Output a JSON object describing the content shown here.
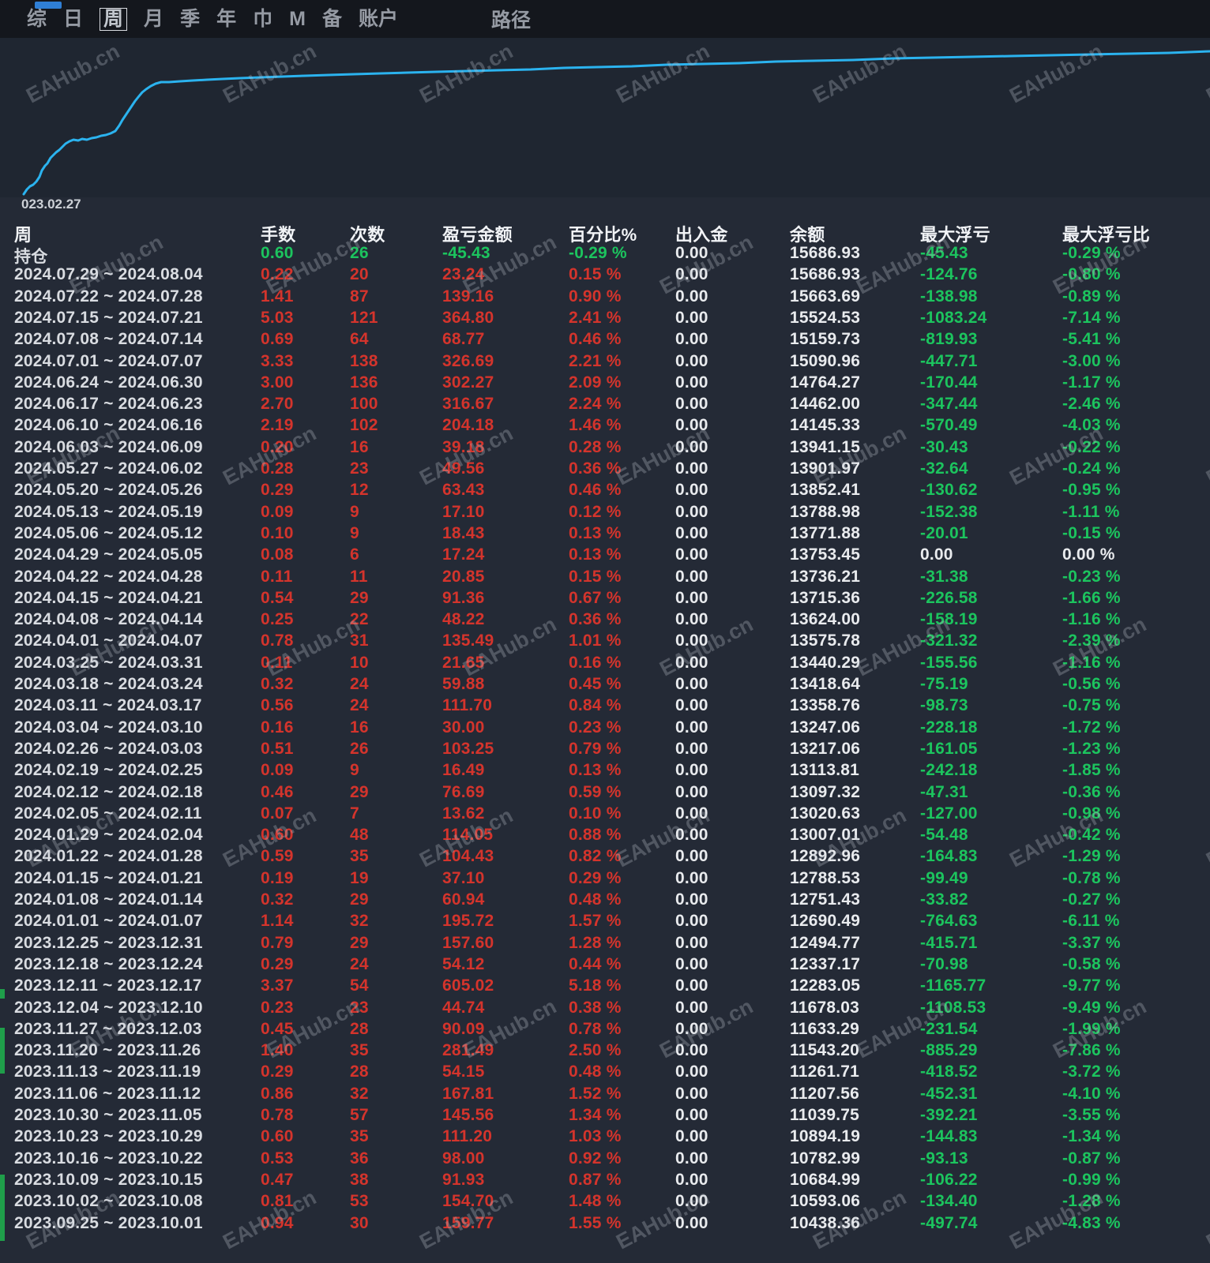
{
  "menu": {
    "items": [
      "综",
      "日",
      "周",
      "月",
      "季",
      "年",
      "巾",
      "M",
      "备",
      "账户"
    ],
    "selected_index": 2,
    "right_item": "路径"
  },
  "watermark": {
    "text": "EAHub.cn"
  },
  "chart": {
    "start_date_label": "023.02.27",
    "line_color": "#2bb3ef"
  },
  "chart_data": {
    "type": "line",
    "title": "",
    "xlabel": "",
    "ylabel": "",
    "x_start_label": "023.02.27",
    "legend": "none",
    "grid": false,
    "line_color": "#2bb3ef",
    "series": [
      {
        "name": "weekly_balance_oldest_to_newest",
        "values": [
          10438.36,
          10593.06,
          10684.99,
          10782.99,
          10894.19,
          11039.75,
          11207.56,
          11261.71,
          11543.2,
          11633.29,
          11678.03,
          12283.05,
          12337.17,
          12494.77,
          12690.49,
          12751.43,
          12788.53,
          12892.96,
          13007.01,
          13020.63,
          13097.32,
          13113.81,
          13217.06,
          13247.06,
          13358.76,
          13418.64,
          13440.29,
          13575.78,
          13624.0,
          13715.36,
          13736.21,
          13753.45,
          13771.88,
          13788.98,
          13852.41,
          13901.97,
          13941.15,
          14145.33,
          14462.0,
          14764.27,
          15090.96,
          15159.73,
          15524.53,
          15663.69,
          15686.93,
          15686.93
        ]
      }
    ],
    "render_points": [
      [
        30,
        246
      ],
      [
        34,
        240
      ],
      [
        38,
        236
      ],
      [
        42,
        234
      ],
      [
        46,
        230
      ],
      [
        50,
        224
      ],
      [
        53,
        216
      ],
      [
        57,
        210
      ],
      [
        60,
        207
      ],
      [
        64,
        200
      ],
      [
        68,
        196
      ],
      [
        71,
        193
      ],
      [
        75,
        190
      ],
      [
        79,
        186
      ],
      [
        83,
        182
      ],
      [
        88,
        179
      ],
      [
        93,
        177
      ],
      [
        99,
        178
      ],
      [
        104,
        176
      ],
      [
        110,
        177
      ],
      [
        116,
        175
      ],
      [
        122,
        174
      ],
      [
        128,
        172
      ],
      [
        134,
        171
      ],
      [
        140,
        169
      ],
      [
        146,
        166
      ],
      [
        151,
        159
      ],
      [
        155,
        152
      ],
      [
        159,
        146
      ],
      [
        163,
        140
      ],
      [
        167,
        134
      ],
      [
        171,
        128
      ],
      [
        175,
        123
      ],
      [
        180,
        117
      ],
      [
        185,
        113
      ],
      [
        191,
        109
      ],
      [
        197,
        106
      ],
      [
        204,
        104
      ],
      [
        214,
        104
      ],
      [
        228,
        103
      ],
      [
        244,
        102
      ],
      [
        262,
        101
      ],
      [
        282,
        100
      ],
      [
        304,
        99
      ],
      [
        330,
        98
      ],
      [
        358,
        97
      ],
      [
        386,
        96
      ],
      [
        416,
        95
      ],
      [
        448,
        94
      ],
      [
        482,
        93
      ],
      [
        516,
        92
      ],
      [
        552,
        91
      ],
      [
        590,
        90
      ],
      [
        630,
        89
      ],
      [
        672,
        88
      ],
      [
        714,
        86
      ],
      [
        756,
        85
      ],
      [
        800,
        84
      ],
      [
        844,
        82
      ],
      [
        890,
        81
      ],
      [
        936,
        80
      ],
      [
        982,
        78
      ],
      [
        1030,
        77
      ],
      [
        1080,
        76
      ],
      [
        1130,
        74
      ],
      [
        1180,
        73
      ],
      [
        1230,
        72
      ],
      [
        1280,
        71
      ],
      [
        1330,
        70
      ],
      [
        1380,
        69
      ],
      [
        1430,
        68
      ],
      [
        1480,
        67
      ],
      [
        1532,
        65
      ]
    ]
  },
  "table": {
    "headers": [
      "周",
      "手数",
      "次数",
      "盈亏金额",
      "百分比%",
      "出入金",
      "余额",
      "最大浮亏",
      "最大浮亏比"
    ],
    "position_row": {
      "label": "持仓",
      "values": [
        "0.60",
        "26",
        "-45.43",
        "-0.29 %",
        "0.00",
        "15686.93",
        "-45.43",
        "-0.29 %"
      ]
    },
    "rows": [
      [
        "2024.07.29 ~ 2024.08.04",
        "0.22",
        "20",
        "23.24",
        "0.15 %",
        "0.00",
        "15686.93",
        "-124.76",
        "-0.80 %"
      ],
      [
        "2024.07.22 ~ 2024.07.28",
        "1.41",
        "87",
        "139.16",
        "0.90 %",
        "0.00",
        "15663.69",
        "-138.98",
        "-0.89 %"
      ],
      [
        "2024.07.15 ~ 2024.07.21",
        "5.03",
        "121",
        "364.80",
        "2.41 %",
        "0.00",
        "15524.53",
        "-1083.24",
        "-7.14 %"
      ],
      [
        "2024.07.08 ~ 2024.07.14",
        "0.69",
        "64",
        "68.77",
        "0.46 %",
        "0.00",
        "15159.73",
        "-819.93",
        "-5.41 %"
      ],
      [
        "2024.07.01 ~ 2024.07.07",
        "3.33",
        "138",
        "326.69",
        "2.21 %",
        "0.00",
        "15090.96",
        "-447.71",
        "-3.00 %"
      ],
      [
        "2024.06.24 ~ 2024.06.30",
        "3.00",
        "136",
        "302.27",
        "2.09 %",
        "0.00",
        "14764.27",
        "-170.44",
        "-1.17 %"
      ],
      [
        "2024.06.17 ~ 2024.06.23",
        "2.70",
        "100",
        "316.67",
        "2.24 %",
        "0.00",
        "14462.00",
        "-347.44",
        "-2.46 %"
      ],
      [
        "2024.06.10 ~ 2024.06.16",
        "2.19",
        "102",
        "204.18",
        "1.46 %",
        "0.00",
        "14145.33",
        "-570.49",
        "-4.03 %"
      ],
      [
        "2024.06.03 ~ 2024.06.09",
        "0.20",
        "16",
        "39.18",
        "0.28 %",
        "0.00",
        "13941.15",
        "-30.43",
        "-0.22 %"
      ],
      [
        "2024.05.27 ~ 2024.06.02",
        "0.28",
        "23",
        "49.56",
        "0.36 %",
        "0.00",
        "13901.97",
        "-32.64",
        "-0.24 %"
      ],
      [
        "2024.05.20 ~ 2024.05.26",
        "0.29",
        "12",
        "63.43",
        "0.46 %",
        "0.00",
        "13852.41",
        "-130.62",
        "-0.95 %"
      ],
      [
        "2024.05.13 ~ 2024.05.19",
        "0.09",
        "9",
        "17.10",
        "0.12 %",
        "0.00",
        "13788.98",
        "-152.38",
        "-1.11 %"
      ],
      [
        "2024.05.06 ~ 2024.05.12",
        "0.10",
        "9",
        "18.43",
        "0.13 %",
        "0.00",
        "13771.88",
        "-20.01",
        "-0.15 %"
      ],
      [
        "2024.04.29 ~ 2024.05.05",
        "0.08",
        "6",
        "17.24",
        "0.13 %",
        "0.00",
        "13753.45",
        "0.00",
        "0.00 %"
      ],
      [
        "2024.04.22 ~ 2024.04.28",
        "0.11",
        "11",
        "20.85",
        "0.15 %",
        "0.00",
        "13736.21",
        "-31.38",
        "-0.23 %"
      ],
      [
        "2024.04.15 ~ 2024.04.21",
        "0.54",
        "29",
        "91.36",
        "0.67 %",
        "0.00",
        "13715.36",
        "-226.58",
        "-1.66 %"
      ],
      [
        "2024.04.08 ~ 2024.04.14",
        "0.25",
        "22",
        "48.22",
        "0.36 %",
        "0.00",
        "13624.00",
        "-158.19",
        "-1.16 %"
      ],
      [
        "2024.04.01 ~ 2024.04.07",
        "0.78",
        "31",
        "135.49",
        "1.01 %",
        "0.00",
        "13575.78",
        "-321.32",
        "-2.39 %"
      ],
      [
        "2024.03.25 ~ 2024.03.31",
        "0.11",
        "10",
        "21.65",
        "0.16 %",
        "0.00",
        "13440.29",
        "-155.56",
        "-1.16 %"
      ],
      [
        "2024.03.18 ~ 2024.03.24",
        "0.32",
        "24",
        "59.88",
        "0.45 %",
        "0.00",
        "13418.64",
        "-75.19",
        "-0.56 %"
      ],
      [
        "2024.03.11 ~ 2024.03.17",
        "0.56",
        "24",
        "111.70",
        "0.84 %",
        "0.00",
        "13358.76",
        "-98.73",
        "-0.75 %"
      ],
      [
        "2024.03.04 ~ 2024.03.10",
        "0.16",
        "16",
        "30.00",
        "0.23 %",
        "0.00",
        "13247.06",
        "-228.18",
        "-1.72 %"
      ],
      [
        "2024.02.26 ~ 2024.03.03",
        "0.51",
        "26",
        "103.25",
        "0.79 %",
        "0.00",
        "13217.06",
        "-161.05",
        "-1.23 %"
      ],
      [
        "2024.02.19 ~ 2024.02.25",
        "0.09",
        "9",
        "16.49",
        "0.13 %",
        "0.00",
        "13113.81",
        "-242.18",
        "-1.85 %"
      ],
      [
        "2024.02.12 ~ 2024.02.18",
        "0.46",
        "29",
        "76.69",
        "0.59 %",
        "0.00",
        "13097.32",
        "-47.31",
        "-0.36 %"
      ],
      [
        "2024.02.05 ~ 2024.02.11",
        "0.07",
        "7",
        "13.62",
        "0.10 %",
        "0.00",
        "13020.63",
        "-127.00",
        "-0.98 %"
      ],
      [
        "2024.01.29 ~ 2024.02.04",
        "0.60",
        "48",
        "114.05",
        "0.88 %",
        "0.00",
        "13007.01",
        "-54.48",
        "-0.42 %"
      ],
      [
        "2024.01.22 ~ 2024.01.28",
        "0.59",
        "35",
        "104.43",
        "0.82 %",
        "0.00",
        "12892.96",
        "-164.83",
        "-1.29 %"
      ],
      [
        "2024.01.15 ~ 2024.01.21",
        "0.19",
        "19",
        "37.10",
        "0.29 %",
        "0.00",
        "12788.53",
        "-99.49",
        "-0.78 %"
      ],
      [
        "2024.01.08 ~ 2024.01.14",
        "0.32",
        "29",
        "60.94",
        "0.48 %",
        "0.00",
        "12751.43",
        "-33.82",
        "-0.27 %"
      ],
      [
        "2024.01.01 ~ 2024.01.07",
        "1.14",
        "32",
        "195.72",
        "1.57 %",
        "0.00",
        "12690.49",
        "-764.63",
        "-6.11 %"
      ],
      [
        "2023.12.25 ~ 2023.12.31",
        "0.79",
        "29",
        "157.60",
        "1.28 %",
        "0.00",
        "12494.77",
        "-415.71",
        "-3.37 %"
      ],
      [
        "2023.12.18 ~ 2023.12.24",
        "0.29",
        "24",
        "54.12",
        "0.44 %",
        "0.00",
        "12337.17",
        "-70.98",
        "-0.58 %"
      ],
      [
        "2023.12.11 ~ 2023.12.17",
        "3.37",
        "54",
        "605.02",
        "5.18 %",
        "0.00",
        "12283.05",
        "-1165.77",
        "-9.77 %"
      ],
      [
        "2023.12.04 ~ 2023.12.10",
        "0.23",
        "23",
        "44.74",
        "0.38 %",
        "0.00",
        "11678.03",
        "-1108.53",
        "-9.49 %"
      ],
      [
        "2023.11.27 ~ 2023.12.03",
        "0.45",
        "28",
        "90.09",
        "0.78 %",
        "0.00",
        "11633.29",
        "-231.54",
        "-1.99 %"
      ],
      [
        "2023.11.20 ~ 2023.11.26",
        "1.40",
        "35",
        "281.49",
        "2.50 %",
        "0.00",
        "11543.20",
        "-885.29",
        "-7.86 %"
      ],
      [
        "2023.11.13 ~ 2023.11.19",
        "0.29",
        "28",
        "54.15",
        "0.48 %",
        "0.00",
        "11261.71",
        "-418.52",
        "-3.72 %"
      ],
      [
        "2023.11.06 ~ 2023.11.12",
        "0.86",
        "32",
        "167.81",
        "1.52 %",
        "0.00",
        "11207.56",
        "-452.31",
        "-4.10 %"
      ],
      [
        "2023.10.30 ~ 2023.11.05",
        "0.78",
        "57",
        "145.56",
        "1.34 %",
        "0.00",
        "11039.75",
        "-392.21",
        "-3.55 %"
      ],
      [
        "2023.10.23 ~ 2023.10.29",
        "0.60",
        "35",
        "111.20",
        "1.03 %",
        "0.00",
        "10894.19",
        "-144.83",
        "-1.34 %"
      ],
      [
        "2023.10.16 ~ 2023.10.22",
        "0.53",
        "36",
        "98.00",
        "0.92 %",
        "0.00",
        "10782.99",
        "-93.13",
        "-0.87 %"
      ],
      [
        "2023.10.09 ~ 2023.10.15",
        "0.47",
        "38",
        "91.93",
        "0.87 %",
        "0.00",
        "10684.99",
        "-106.22",
        "-0.99 %"
      ],
      [
        "2023.10.02 ~ 2023.10.08",
        "0.81",
        "53",
        "154.70",
        "1.48 %",
        "0.00",
        "10593.06",
        "-134.40",
        "-1.28 %"
      ],
      [
        "2023.09.25 ~ 2023.10.01",
        "0.94",
        "30",
        "159.77",
        "1.55 %",
        "0.00",
        "10438.36",
        "-497.74",
        "-4.83 %"
      ]
    ]
  }
}
